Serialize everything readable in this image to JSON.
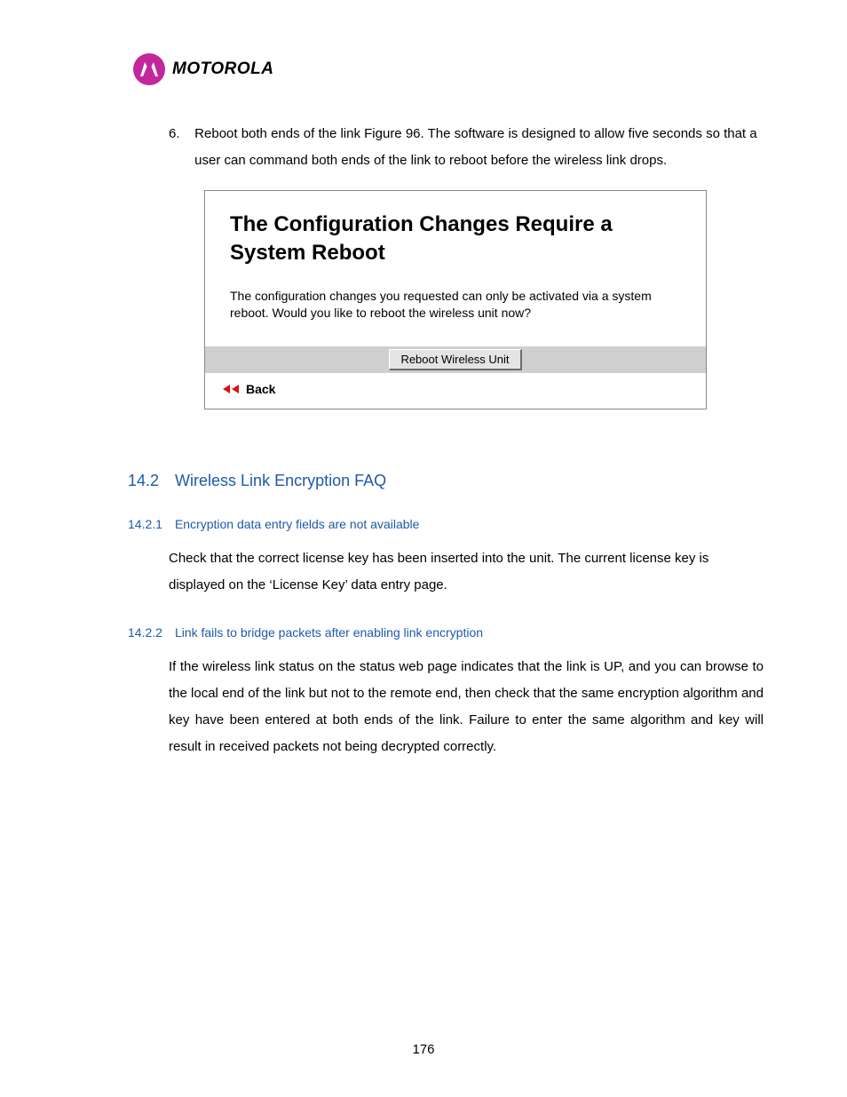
{
  "brand": "MOTOROLA",
  "list_item": {
    "number": "6.",
    "text": "Reboot both ends of the link Figure 96. The software is designed to allow five seconds so that a user can command both ends of the link to reboot before the wireless link drops."
  },
  "figure": {
    "title": "The Configuration Changes Require a System Reboot",
    "description": "The configuration changes you requested can only be activated via a system reboot. Would you like to reboot the wireless unit now?",
    "button_label": "Reboot Wireless Unit",
    "back_label": "Back"
  },
  "section_14_2": {
    "number": "14.2",
    "title": "Wireless Link Encryption FAQ"
  },
  "section_14_2_1": {
    "number": "14.2.1",
    "title": "Encryption data entry fields are not available",
    "body": "Check that the correct license key has been inserted into the unit. The current license key is displayed on the ‘License Key’ data entry page."
  },
  "section_14_2_2": {
    "number": "14.2.2",
    "title": "Link fails to bridge packets after enabling link encryption",
    "body": "If the wireless link status on the status web page indicates that the link is UP, and you can browse to the local end of the link but not to the remote end, then check that the same encryption algorithm and key have been entered at both ends of the link. Failure to enter the same algorithm and key will result in received packets not being decrypted correctly."
  },
  "page_number": "176"
}
